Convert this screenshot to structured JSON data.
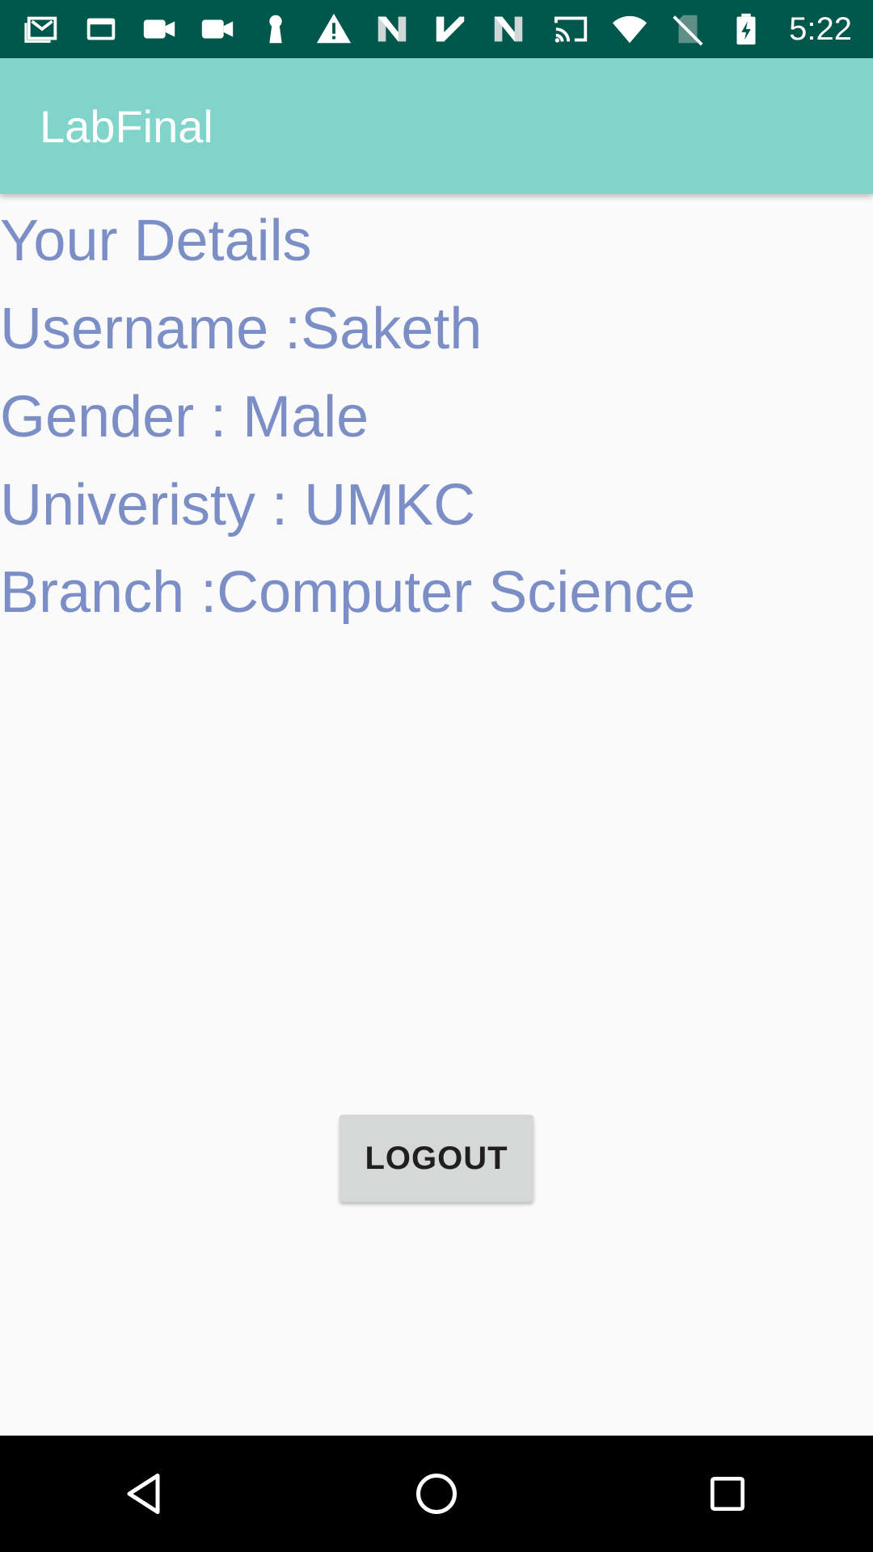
{
  "status_bar": {
    "time": "5:22",
    "icons_left": [
      "gmail-icon",
      "window-icon",
      "video-icon",
      "video-icon",
      "keyhole-icon",
      "warning-icon",
      "n-logo-icon",
      "check-icon",
      "n-logo-icon"
    ],
    "icons_right": [
      "cast-icon",
      "wifi-icon",
      "no-sim-icon",
      "battery-charging-icon"
    ],
    "background": "#00574b"
  },
  "app_bar": {
    "title": "LabFinal",
    "background": "#80d4c9"
  },
  "details": {
    "heading": "Your Details",
    "username": "Username :Saketh",
    "gender": "Gender : Male",
    "university": "Univeristy : UMKC",
    "branch": "Branch :Computer Science",
    "text_color": "#7c8ec6"
  },
  "logout_button": {
    "label": "LOGOUT"
  },
  "nav_bar": {
    "buttons": [
      "back-icon",
      "home-icon",
      "recents-icon"
    ]
  }
}
